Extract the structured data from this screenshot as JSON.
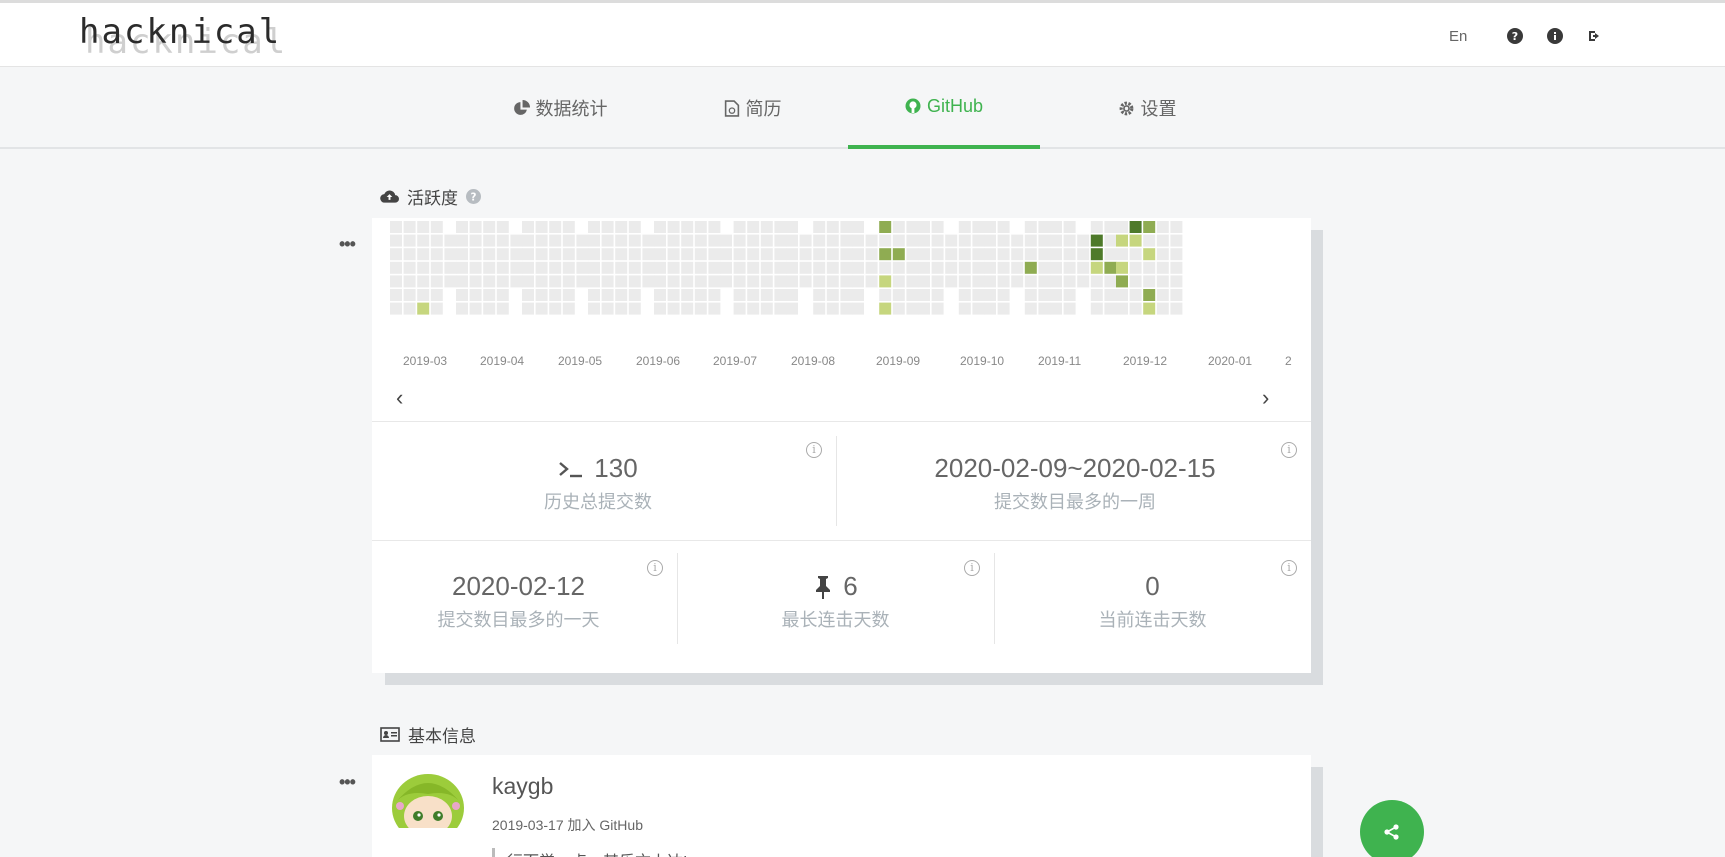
{
  "header": {
    "logo": "hacknical",
    "lang": "En",
    "icons": [
      "question-circle-icon",
      "info-circle-icon",
      "sign-out-icon"
    ]
  },
  "tabs": [
    {
      "label": "数据统计",
      "icon": "pie-chart-icon"
    },
    {
      "label": "简历",
      "icon": "document-icon"
    },
    {
      "label": "GitHub",
      "icon": "github-icon",
      "active": true
    },
    {
      "label": "设置",
      "icon": "gear-icon"
    }
  ],
  "activity": {
    "title": "活跃度",
    "months": [
      "2019-03",
      "2019-04",
      "2019-05",
      "2019-06",
      "2019-07",
      "2019-08",
      "2019-09",
      "2019-10",
      "2019-11",
      "2019-12",
      "2020-01",
      "2"
    ],
    "heatmap": {
      "levels": [
        0,
        1,
        2,
        3
      ],
      "colors": [
        "#ebebeb",
        "#c6d67e",
        "#8fac52",
        "#4e7a2a"
      ]
    }
  },
  "stats": {
    "total_commits": {
      "value": "130",
      "label": "历史总提交数"
    },
    "max_week": {
      "value": "2020-02-09~2020-02-15",
      "label": "提交数目最多的一周"
    },
    "max_day": {
      "value": "2020-02-12",
      "label": "提交数目最多的一天"
    },
    "longest_streak": {
      "value": "6",
      "label": "最长连击天数"
    },
    "current_streak": {
      "value": "0",
      "label": "当前连击天数"
    }
  },
  "basic_info": {
    "title": "基本信息",
    "username": "kaygb",
    "joined_date": "2019-03-17",
    "joined_suffix": "加入 GitHub",
    "bio": "行而学一点，其乐亦上达!"
  },
  "colors": {
    "accent": "#3fb34f"
  }
}
